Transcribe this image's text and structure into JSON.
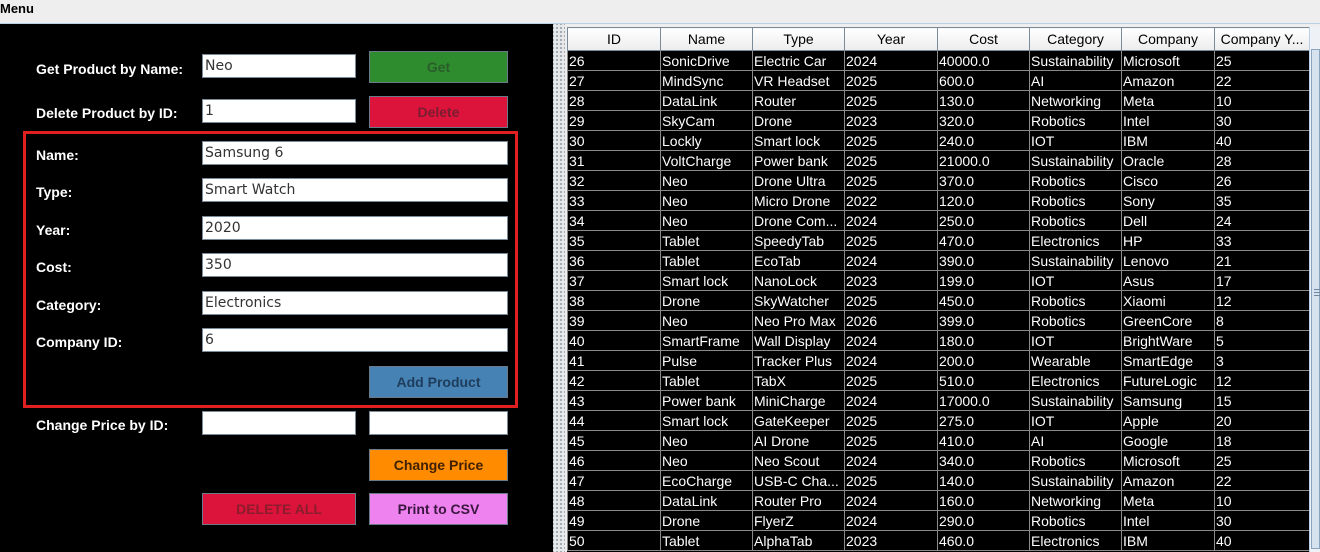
{
  "menubar": {
    "menu_label": "Menu"
  },
  "form": {
    "get_label": "Get Product by Name:",
    "get_value": "Neo",
    "get_button": "Get",
    "delete_label": "Delete Product by ID:",
    "delete_value": "1",
    "delete_button": "Delete",
    "name_label": "Name:",
    "name_value": "Samsung 6",
    "type_label": "Type:",
    "type_value": "Smart Watch",
    "year_label": "Year:",
    "year_value": "2020",
    "cost_label": "Cost:",
    "cost_value": "350",
    "category_label": "Category:",
    "category_value": "Electronics",
    "company_label": "Company ID:",
    "company_value": "6",
    "add_button": "Add Product",
    "change_label": "Change Price by ID:",
    "change_id_value": "",
    "change_price_value": "",
    "change_button": "Change Price",
    "delete_all_button": "DELETE ALL",
    "print_button": "Print to CSV"
  },
  "colors": {
    "get": "#2e8b2e",
    "delete": "#dc143c",
    "add": "#4682b4",
    "change": "#ff8c00",
    "delete_all": "#dc143c",
    "print": "#ee82ee",
    "highlight_box": "#e02020"
  },
  "table": {
    "headers": [
      "ID",
      "Name",
      "Type",
      "Year",
      "Cost",
      "Category",
      "Company",
      "Company Y..."
    ],
    "rows": [
      [
        "26",
        "SonicDrive",
        "Electric Car",
        "2024",
        "40000.0",
        "Sustainability",
        "Microsoft",
        "25"
      ],
      [
        "27",
        "MindSync",
        "VR Headset",
        "2025",
        "600.0",
        "AI",
        "Amazon",
        "22"
      ],
      [
        "28",
        "DataLink",
        "Router",
        "2025",
        "130.0",
        "Networking",
        "Meta",
        "10"
      ],
      [
        "29",
        "SkyCam",
        "Drone",
        "2023",
        "320.0",
        "Robotics",
        "Intel",
        "30"
      ],
      [
        "30",
        "Lockly",
        "Smart lock",
        "2025",
        "240.0",
        "IOT",
        "IBM",
        "40"
      ],
      [
        "31",
        "VoltCharge",
        "Power bank",
        "2025",
        "21000.0",
        "Sustainability",
        "Oracle",
        "28"
      ],
      [
        "32",
        "Neo",
        "Drone Ultra",
        "2025",
        "370.0",
        "Robotics",
        "Cisco",
        "26"
      ],
      [
        "33",
        "Neo",
        "Micro Drone",
        "2022",
        "120.0",
        "Robotics",
        "Sony",
        "35"
      ],
      [
        "34",
        "Neo",
        "Drone Com...",
        "2024",
        "250.0",
        "Robotics",
        "Dell",
        "24"
      ],
      [
        "35",
        "Tablet",
        "SpeedyTab",
        "2025",
        "470.0",
        "Electronics",
        "HP",
        "33"
      ],
      [
        "36",
        "Tablet",
        "EcoTab",
        "2024",
        "390.0",
        "Sustainability",
        "Lenovo",
        "21"
      ],
      [
        "37",
        "Smart lock",
        "NanoLock",
        "2023",
        "199.0",
        "IOT",
        "Asus",
        "17"
      ],
      [
        "38",
        "Drone",
        "SkyWatcher",
        "2025",
        "450.0",
        "Robotics",
        "Xiaomi",
        "12"
      ],
      [
        "39",
        "Neo",
        "Neo Pro Max",
        "2026",
        "399.0",
        "Robotics",
        "GreenCore",
        "8"
      ],
      [
        "40",
        "SmartFrame",
        "Wall Display",
        "2024",
        "180.0",
        "IOT",
        "BrightWare",
        "5"
      ],
      [
        "41",
        "Pulse",
        "Tracker Plus",
        "2024",
        "200.0",
        "Wearable",
        "SmartEdge",
        "3"
      ],
      [
        "42",
        "Tablet",
        "TabX",
        "2025",
        "510.0",
        "Electronics",
        "FutureLogic",
        "12"
      ],
      [
        "43",
        "Power bank",
        "MiniCharge",
        "2024",
        "17000.0",
        "Sustainability",
        "Samsung",
        "15"
      ],
      [
        "44",
        "Smart lock",
        "GateKeeper",
        "2025",
        "275.0",
        "IOT",
        "Apple",
        "20"
      ],
      [
        "45",
        "Neo",
        "AI Drone",
        "2025",
        "410.0",
        "AI",
        "Google",
        "18"
      ],
      [
        "46",
        "Neo",
        "Neo Scout",
        "2024",
        "340.0",
        "Robotics",
        "Microsoft",
        "25"
      ],
      [
        "47",
        "EcoCharge",
        "USB-C Cha...",
        "2025",
        "140.0",
        "Sustainability",
        "Amazon",
        "22"
      ],
      [
        "48",
        "DataLink",
        "Router Pro",
        "2024",
        "160.0",
        "Networking",
        "Meta",
        "10"
      ],
      [
        "49",
        "Drone",
        "FlyerZ",
        "2024",
        "290.0",
        "Robotics",
        "Intel",
        "30"
      ],
      [
        "50",
        "Tablet",
        "AlphaTab",
        "2023",
        "460.0",
        "Electronics",
        "IBM",
        "40"
      ]
    ]
  }
}
